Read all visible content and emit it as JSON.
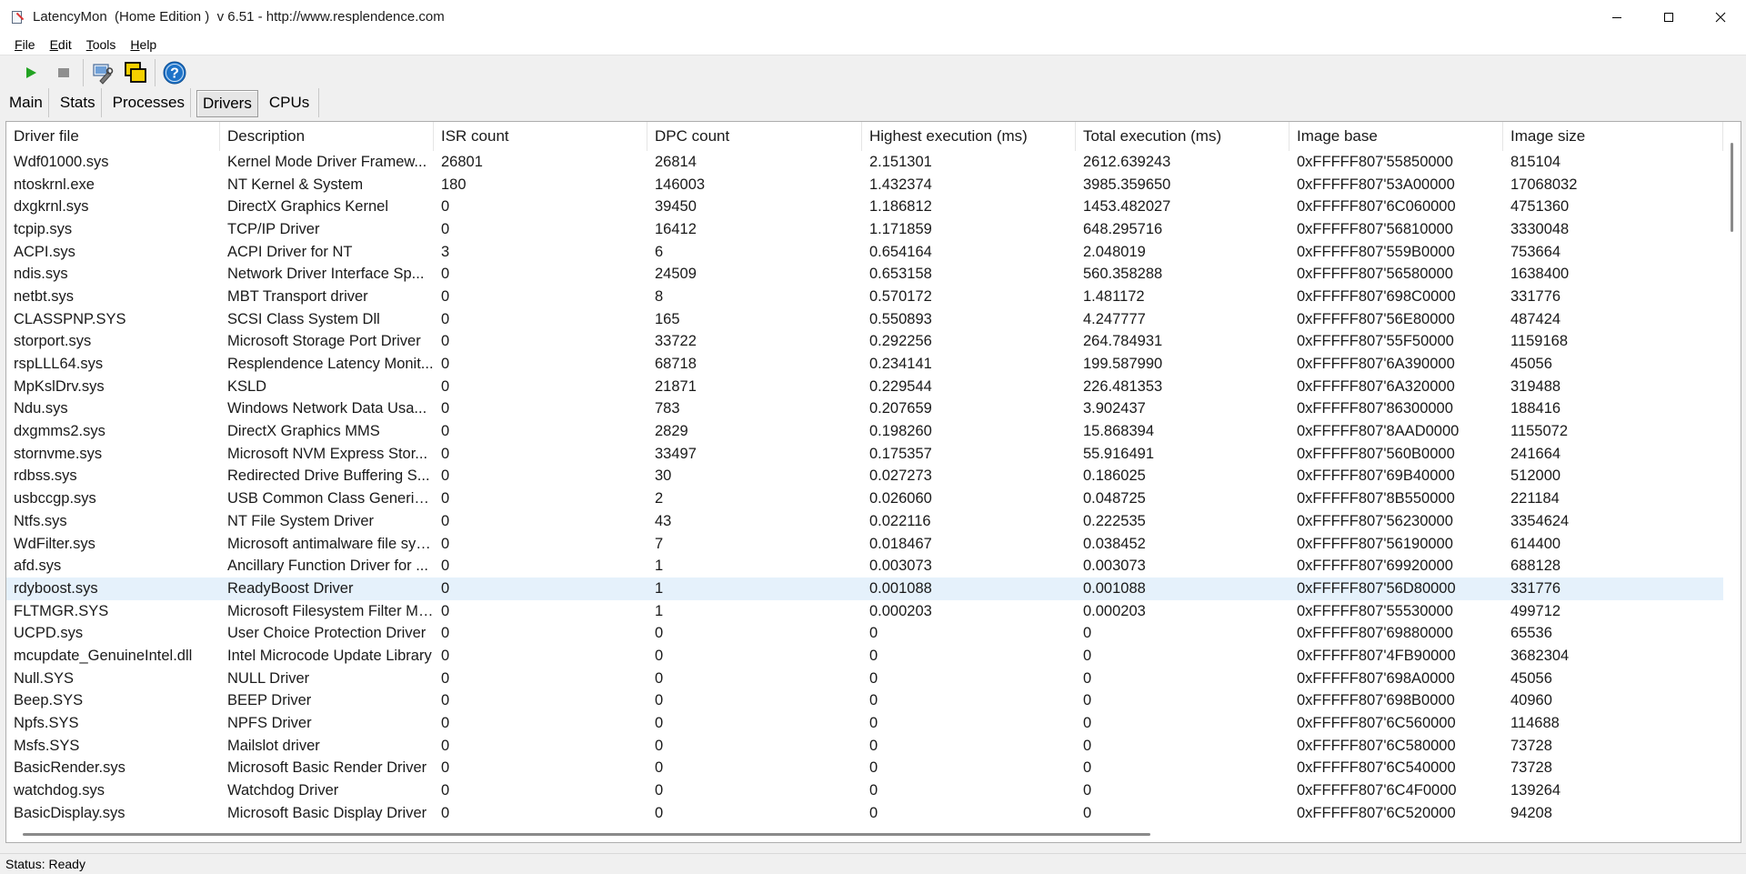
{
  "window": {
    "title": "LatencyMon  (Home Edition )  v 6.51 - http://www.resplendence.com",
    "minimize_icon": "minimize-icon",
    "maximize_icon": "maximize-icon",
    "close_icon": "close-icon"
  },
  "menu": [
    {
      "accel": "F",
      "rest": "ile"
    },
    {
      "accel": "E",
      "rest": "dit"
    },
    {
      "accel": "T",
      "rest": "ools"
    },
    {
      "accel": "H",
      "rest": "elp"
    }
  ],
  "toolbar": {
    "icons": [
      "play-icon",
      "stop-icon",
      "wrench-icon",
      "windows-icon",
      "help-icon"
    ],
    "colors": {
      "play": "#22a322",
      "stop": "#8f8f8f",
      "help": "#1e73c8",
      "windows_fill": "#f4d000"
    }
  },
  "tabs": [
    {
      "label": "Main",
      "active": false
    },
    {
      "label": "Stats",
      "active": false
    },
    {
      "label": "Processes",
      "active": false
    },
    {
      "label": "Drivers",
      "active": true
    },
    {
      "label": "CPUs",
      "active": false
    }
  ],
  "table": {
    "columns": [
      "Driver file",
      "Description",
      "ISR count",
      "DPC count",
      "Highest execution (ms)",
      "Total execution (ms)",
      "Image base",
      "Image size"
    ],
    "selected_row_color": "#e5f1fb",
    "rows": [
      [
        "Wdf01000.sys",
        "Kernel Mode Driver Framew...",
        "26801",
        "26814",
        "2.151301",
        "2612.639243",
        "0xFFFFF807'55850000",
        "815104"
      ],
      [
        "ntoskrnl.exe",
        "NT Kernel & System",
        "180",
        "146003",
        "1.432374",
        "3985.359650",
        "0xFFFFF807'53A00000",
        "17068032"
      ],
      [
        "dxgkrnl.sys",
        "DirectX Graphics Kernel",
        "0",
        "39450",
        "1.186812",
        "1453.482027",
        "0xFFFFF807'6C060000",
        "4751360"
      ],
      [
        "tcpip.sys",
        "TCP/IP Driver",
        "0",
        "16412",
        "1.171859",
        "648.295716",
        "0xFFFFF807'56810000",
        "3330048"
      ],
      [
        "ACPI.sys",
        "ACPI Driver for NT",
        "3",
        "6",
        "0.654164",
        "2.048019",
        "0xFFFFF807'559B0000",
        "753664"
      ],
      [
        "ndis.sys",
        "Network Driver Interface Sp...",
        "0",
        "24509",
        "0.653158",
        "560.358288",
        "0xFFFFF807'56580000",
        "1638400"
      ],
      [
        "netbt.sys",
        "MBT Transport driver",
        "0",
        "8",
        "0.570172",
        "1.481172",
        "0xFFFFF807'698C0000",
        "331776"
      ],
      [
        "CLASSPNP.SYS",
        "SCSI Class System Dll",
        "0",
        "165",
        "0.550893",
        "4.247777",
        "0xFFFFF807'56E80000",
        "487424"
      ],
      [
        "storport.sys",
        "Microsoft Storage Port Driver",
        "0",
        "33722",
        "0.292256",
        "264.784931",
        "0xFFFFF807'55F50000",
        "1159168"
      ],
      [
        "rspLLL64.sys",
        "Resplendence Latency Monit...",
        "0",
        "68718",
        "0.234141",
        "199.587990",
        "0xFFFFF807'6A390000",
        "45056"
      ],
      [
        "MpKslDrv.sys",
        "KSLD",
        "0",
        "21871",
        "0.229544",
        "226.481353",
        "0xFFFFF807'6A320000",
        "319488"
      ],
      [
        "Ndu.sys",
        "Windows Network Data Usa...",
        "0",
        "783",
        "0.207659",
        "3.902437",
        "0xFFFFF807'86300000",
        "188416"
      ],
      [
        "dxgmms2.sys",
        "DirectX Graphics MMS",
        "0",
        "2829",
        "0.198260",
        "15.868394",
        "0xFFFFF807'8AAD0000",
        "1155072"
      ],
      [
        "stornvme.sys",
        "Microsoft NVM Express Stor...",
        "0",
        "33497",
        "0.175357",
        "55.916491",
        "0xFFFFF807'560B0000",
        "241664"
      ],
      [
        "rdbss.sys",
        "Redirected Drive Buffering S...",
        "0",
        "30",
        "0.027273",
        "0.186025",
        "0xFFFFF807'69B40000",
        "512000"
      ],
      [
        "usbccgp.sys",
        "USB Common Class Generic ...",
        "0",
        "2",
        "0.026060",
        "0.048725",
        "0xFFFFF807'8B550000",
        "221184"
      ],
      [
        "Ntfs.sys",
        "NT File System Driver",
        "0",
        "43",
        "0.022116",
        "0.222535",
        "0xFFFFF807'56230000",
        "3354624"
      ],
      [
        "WdFilter.sys",
        "Microsoft antimalware file sys...",
        "0",
        "7",
        "0.018467",
        "0.038452",
        "0xFFFFF807'56190000",
        "614400"
      ],
      [
        "afd.sys",
        "Ancillary Function Driver for ...",
        "0",
        "1",
        "0.003073",
        "0.003073",
        "0xFFFFF807'69920000",
        "688128"
      ],
      [
        "rdyboost.sys",
        "ReadyBoost Driver",
        "0",
        "1",
        "0.001088",
        "0.001088",
        "0xFFFFF807'56D80000",
        "331776"
      ],
      [
        "FLTMGR.SYS",
        "Microsoft Filesystem Filter Ma...",
        "0",
        "1",
        "0.000203",
        "0.000203",
        "0xFFFFF807'55530000",
        "499712"
      ],
      [
        "UCPD.sys",
        "User Choice Protection Driver",
        "0",
        "0",
        "0",
        "0",
        "0xFFFFF807'69880000",
        "65536"
      ],
      [
        "mcupdate_GenuineIntel.dll",
        "Intel Microcode Update Library",
        "0",
        "0",
        "0",
        "0",
        "0xFFFFF807'4FB90000",
        "3682304"
      ],
      [
        "Null.SYS",
        "NULL Driver",
        "0",
        "0",
        "0",
        "0",
        "0xFFFFF807'698A0000",
        "45056"
      ],
      [
        "Beep.SYS",
        "BEEP Driver",
        "0",
        "0",
        "0",
        "0",
        "0xFFFFF807'698B0000",
        "40960"
      ],
      [
        "Npfs.SYS",
        "NPFS Driver",
        "0",
        "0",
        "0",
        "0",
        "0xFFFFF807'6C560000",
        "114688"
      ],
      [
        "Msfs.SYS",
        "Mailslot driver",
        "0",
        "0",
        "0",
        "0",
        "0xFFFFF807'6C580000",
        "73728"
      ],
      [
        "BasicRender.sys",
        "Microsoft Basic Render Driver",
        "0",
        "0",
        "0",
        "0",
        "0xFFFFF807'6C540000",
        "73728"
      ],
      [
        "watchdog.sys",
        "Watchdog Driver",
        "0",
        "0",
        "0",
        "0",
        "0xFFFFF807'6C4F0000",
        "139264"
      ],
      [
        "BasicDisplay.sys",
        "Microsoft Basic Display Driver",
        "0",
        "0",
        "0",
        "0",
        "0xFFFFF807'6C520000",
        "94208"
      ]
    ],
    "selected_index": 19
  },
  "status": {
    "text": "Status: Ready"
  }
}
